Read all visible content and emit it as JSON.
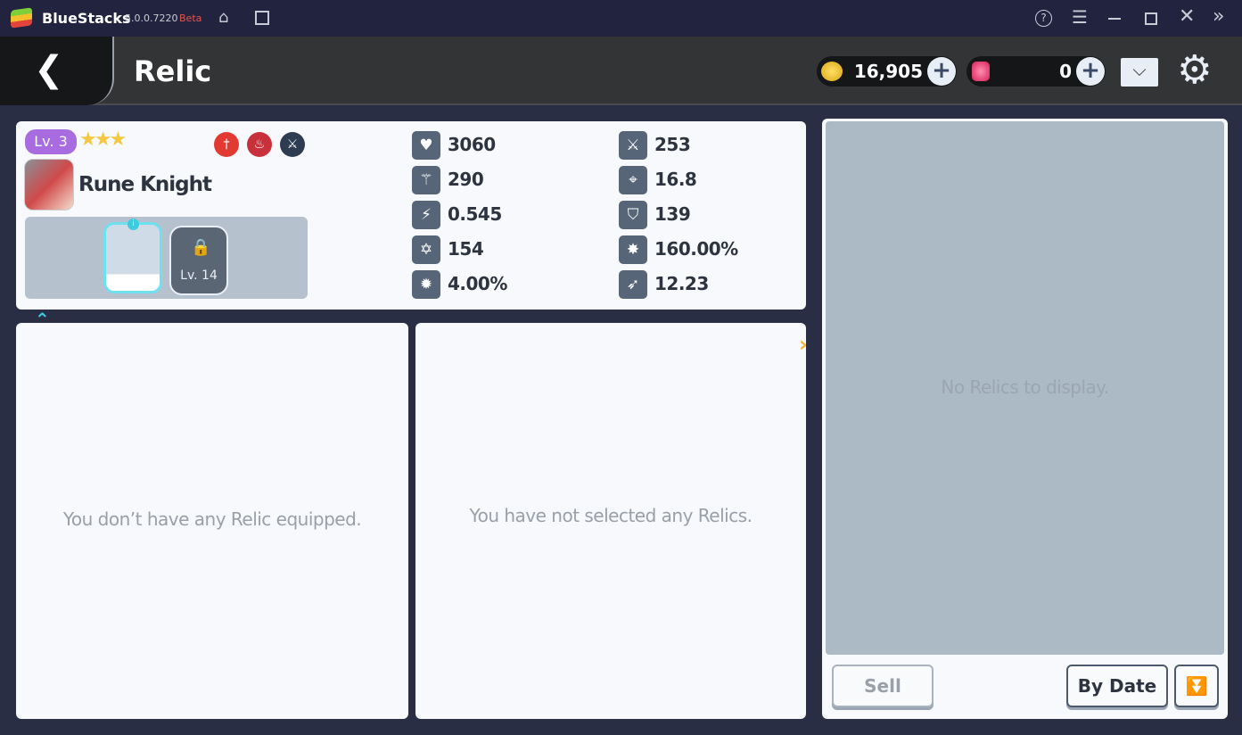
{
  "window": {
    "app": "BlueStacks",
    "version": "5.0.0.7220",
    "channel": "Beta",
    "controls": [
      "help-icon",
      "menu-icon",
      "minimize-icon",
      "maximize-icon",
      "close-icon",
      "expand-sidebar-icon"
    ]
  },
  "header": {
    "title": "Relic",
    "gold": "16,905",
    "gems": "0"
  },
  "hero": {
    "level": "Lv. 3",
    "stars": 3,
    "name": "Rune Knight",
    "slot_lock_level": "Lv. 14",
    "slot_badge": "i",
    "stats": [
      {
        "icon": "hp-icon",
        "value": "3060"
      },
      {
        "icon": "attack-icon",
        "value": "253"
      },
      {
        "icon": "magic-icon",
        "value": "290"
      },
      {
        "icon": "accuracy-icon",
        "value": "16.8"
      },
      {
        "icon": "attack-speed-icon",
        "value": "0.545"
      },
      {
        "icon": "defense-icon",
        "value": "139"
      },
      {
        "icon": "magic-defense-icon",
        "value": "154"
      },
      {
        "icon": "crit-damage-icon",
        "value": "160.00%"
      },
      {
        "icon": "crit-rate-icon",
        "value": "4.00%"
      },
      {
        "icon": "speed-icon",
        "value": "12.23"
      }
    ]
  },
  "panels": {
    "equipped_empty": "You don’t have any Relic equipped.",
    "selected_empty": "You have not selected any Relics.",
    "inventory_empty": "No Relics to display."
  },
  "buttons": {
    "sell": "Sell",
    "sort": "By Date"
  },
  "colors": {
    "level_badge": "#a86be0",
    "inventory_bg": "#acbac6",
    "accent_arrow": "#f5b530"
  }
}
